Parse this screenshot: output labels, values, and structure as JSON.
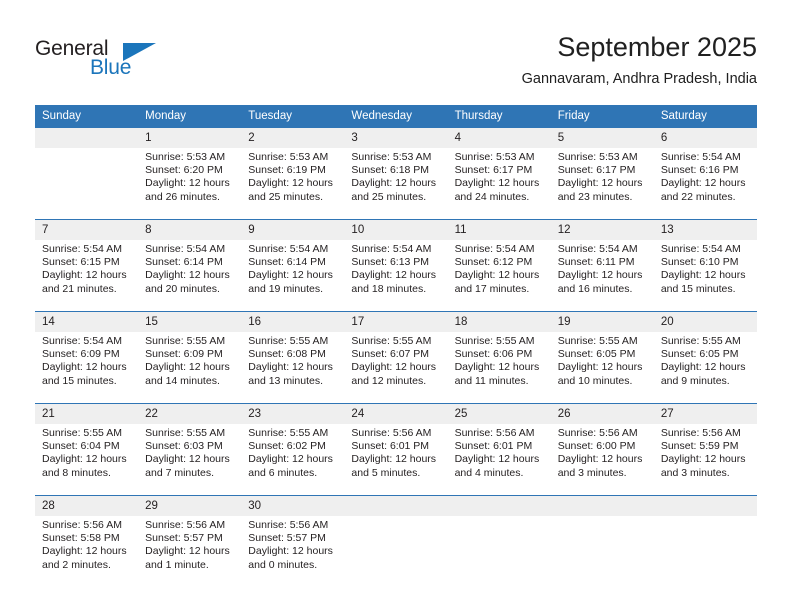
{
  "brand": {
    "name_part1": "General",
    "name_part2": "Blue"
  },
  "header": {
    "title": "September 2025",
    "subtitle": "Gannavaram, Andhra Pradesh, India"
  },
  "colors": {
    "header_blue": "#2f75b5",
    "daynum_band": "#efefef",
    "text": "#231f20",
    "logo_blue": "#1b75bb"
  },
  "calendar": {
    "weekday_headers": [
      "Sunday",
      "Monday",
      "Tuesday",
      "Wednesday",
      "Thursday",
      "Friday",
      "Saturday"
    ],
    "weeks": [
      [
        {
          "day": "",
          "sunrise": "",
          "sunset": "",
          "daylight1": "",
          "daylight2": ""
        },
        {
          "day": "1",
          "sunrise": "Sunrise: 5:53 AM",
          "sunset": "Sunset: 6:20 PM",
          "daylight1": "Daylight: 12 hours",
          "daylight2": "and 26 minutes."
        },
        {
          "day": "2",
          "sunrise": "Sunrise: 5:53 AM",
          "sunset": "Sunset: 6:19 PM",
          "daylight1": "Daylight: 12 hours",
          "daylight2": "and 25 minutes."
        },
        {
          "day": "3",
          "sunrise": "Sunrise: 5:53 AM",
          "sunset": "Sunset: 6:18 PM",
          "daylight1": "Daylight: 12 hours",
          "daylight2": "and 25 minutes."
        },
        {
          "day": "4",
          "sunrise": "Sunrise: 5:53 AM",
          "sunset": "Sunset: 6:17 PM",
          "daylight1": "Daylight: 12 hours",
          "daylight2": "and 24 minutes."
        },
        {
          "day": "5",
          "sunrise": "Sunrise: 5:53 AM",
          "sunset": "Sunset: 6:17 PM",
          "daylight1": "Daylight: 12 hours",
          "daylight2": "and 23 minutes."
        },
        {
          "day": "6",
          "sunrise": "Sunrise: 5:54 AM",
          "sunset": "Sunset: 6:16 PM",
          "daylight1": "Daylight: 12 hours",
          "daylight2": "and 22 minutes."
        }
      ],
      [
        {
          "day": "7",
          "sunrise": "Sunrise: 5:54 AM",
          "sunset": "Sunset: 6:15 PM",
          "daylight1": "Daylight: 12 hours",
          "daylight2": "and 21 minutes."
        },
        {
          "day": "8",
          "sunrise": "Sunrise: 5:54 AM",
          "sunset": "Sunset: 6:14 PM",
          "daylight1": "Daylight: 12 hours",
          "daylight2": "and 20 minutes."
        },
        {
          "day": "9",
          "sunrise": "Sunrise: 5:54 AM",
          "sunset": "Sunset: 6:14 PM",
          "daylight1": "Daylight: 12 hours",
          "daylight2": "and 19 minutes."
        },
        {
          "day": "10",
          "sunrise": "Sunrise: 5:54 AM",
          "sunset": "Sunset: 6:13 PM",
          "daylight1": "Daylight: 12 hours",
          "daylight2": "and 18 minutes."
        },
        {
          "day": "11",
          "sunrise": "Sunrise: 5:54 AM",
          "sunset": "Sunset: 6:12 PM",
          "daylight1": "Daylight: 12 hours",
          "daylight2": "and 17 minutes."
        },
        {
          "day": "12",
          "sunrise": "Sunrise: 5:54 AM",
          "sunset": "Sunset: 6:11 PM",
          "daylight1": "Daylight: 12 hours",
          "daylight2": "and 16 minutes."
        },
        {
          "day": "13",
          "sunrise": "Sunrise: 5:54 AM",
          "sunset": "Sunset: 6:10 PM",
          "daylight1": "Daylight: 12 hours",
          "daylight2": "and 15 minutes."
        }
      ],
      [
        {
          "day": "14",
          "sunrise": "Sunrise: 5:54 AM",
          "sunset": "Sunset: 6:09 PM",
          "daylight1": "Daylight: 12 hours",
          "daylight2": "and 15 minutes."
        },
        {
          "day": "15",
          "sunrise": "Sunrise: 5:55 AM",
          "sunset": "Sunset: 6:09 PM",
          "daylight1": "Daylight: 12 hours",
          "daylight2": "and 14 minutes."
        },
        {
          "day": "16",
          "sunrise": "Sunrise: 5:55 AM",
          "sunset": "Sunset: 6:08 PM",
          "daylight1": "Daylight: 12 hours",
          "daylight2": "and 13 minutes."
        },
        {
          "day": "17",
          "sunrise": "Sunrise: 5:55 AM",
          "sunset": "Sunset: 6:07 PM",
          "daylight1": "Daylight: 12 hours",
          "daylight2": "and 12 minutes."
        },
        {
          "day": "18",
          "sunrise": "Sunrise: 5:55 AM",
          "sunset": "Sunset: 6:06 PM",
          "daylight1": "Daylight: 12 hours",
          "daylight2": "and 11 minutes."
        },
        {
          "day": "19",
          "sunrise": "Sunrise: 5:55 AM",
          "sunset": "Sunset: 6:05 PM",
          "daylight1": "Daylight: 12 hours",
          "daylight2": "and 10 minutes."
        },
        {
          "day": "20",
          "sunrise": "Sunrise: 5:55 AM",
          "sunset": "Sunset: 6:05 PM",
          "daylight1": "Daylight: 12 hours",
          "daylight2": "and 9 minutes."
        }
      ],
      [
        {
          "day": "21",
          "sunrise": "Sunrise: 5:55 AM",
          "sunset": "Sunset: 6:04 PM",
          "daylight1": "Daylight: 12 hours",
          "daylight2": "and 8 minutes."
        },
        {
          "day": "22",
          "sunrise": "Sunrise: 5:55 AM",
          "sunset": "Sunset: 6:03 PM",
          "daylight1": "Daylight: 12 hours",
          "daylight2": "and 7 minutes."
        },
        {
          "day": "23",
          "sunrise": "Sunrise: 5:55 AM",
          "sunset": "Sunset: 6:02 PM",
          "daylight1": "Daylight: 12 hours",
          "daylight2": "and 6 minutes."
        },
        {
          "day": "24",
          "sunrise": "Sunrise: 5:56 AM",
          "sunset": "Sunset: 6:01 PM",
          "daylight1": "Daylight: 12 hours",
          "daylight2": "and 5 minutes."
        },
        {
          "day": "25",
          "sunrise": "Sunrise: 5:56 AM",
          "sunset": "Sunset: 6:01 PM",
          "daylight1": "Daylight: 12 hours",
          "daylight2": "and 4 minutes."
        },
        {
          "day": "26",
          "sunrise": "Sunrise: 5:56 AM",
          "sunset": "Sunset: 6:00 PM",
          "daylight1": "Daylight: 12 hours",
          "daylight2": "and 3 minutes."
        },
        {
          "day": "27",
          "sunrise": "Sunrise: 5:56 AM",
          "sunset": "Sunset: 5:59 PM",
          "daylight1": "Daylight: 12 hours",
          "daylight2": "and 3 minutes."
        }
      ],
      [
        {
          "day": "28",
          "sunrise": "Sunrise: 5:56 AM",
          "sunset": "Sunset: 5:58 PM",
          "daylight1": "Daylight: 12 hours",
          "daylight2": "and 2 minutes."
        },
        {
          "day": "29",
          "sunrise": "Sunrise: 5:56 AM",
          "sunset": "Sunset: 5:57 PM",
          "daylight1": "Daylight: 12 hours",
          "daylight2": "and 1 minute."
        },
        {
          "day": "30",
          "sunrise": "Sunrise: 5:56 AM",
          "sunset": "Sunset: 5:57 PM",
          "daylight1": "Daylight: 12 hours",
          "daylight2": "and 0 minutes."
        },
        {
          "day": "",
          "sunrise": "",
          "sunset": "",
          "daylight1": "",
          "daylight2": ""
        },
        {
          "day": "",
          "sunrise": "",
          "sunset": "",
          "daylight1": "",
          "daylight2": ""
        },
        {
          "day": "",
          "sunrise": "",
          "sunset": "",
          "daylight1": "",
          "daylight2": ""
        },
        {
          "day": "",
          "sunrise": "",
          "sunset": "",
          "daylight1": "",
          "daylight2": ""
        }
      ]
    ]
  }
}
